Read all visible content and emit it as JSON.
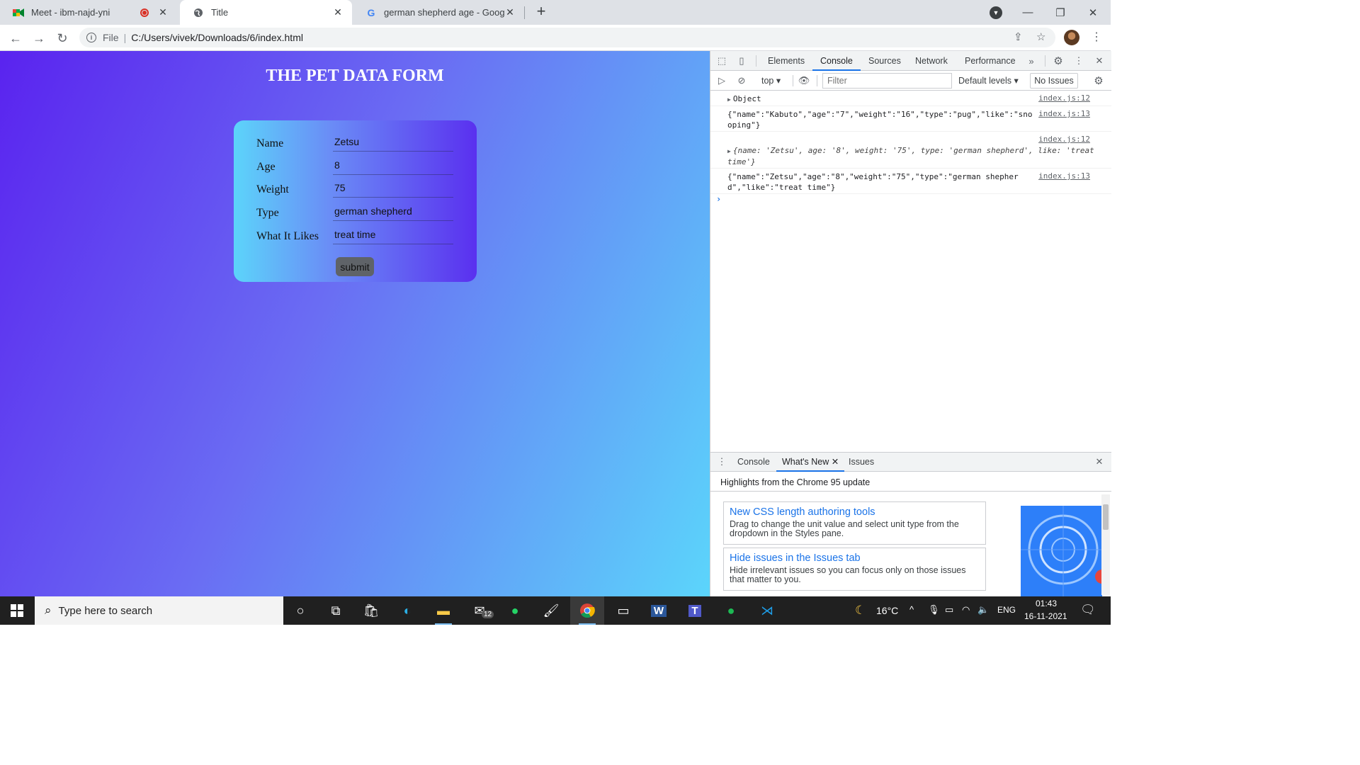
{
  "tabs": [
    {
      "title": "Meet - ibm-najd-yni"
    },
    {
      "title": "Title"
    },
    {
      "title": "german shepherd age - Google S"
    }
  ],
  "address": {
    "scheme": "File",
    "path": "C:/Users/vivek/Downloads/6/index.html"
  },
  "page": {
    "heading": "THE PET DATA FORM",
    "fields": [
      {
        "label": "Name",
        "value": "Zetsu"
      },
      {
        "label": "Age",
        "value": "8"
      },
      {
        "label": "Weight",
        "value": "75"
      },
      {
        "label": "Type",
        "value": "german shepherd"
      },
      {
        "label": "What It Likes",
        "value": "treat time"
      }
    ],
    "submit_label": "submit"
  },
  "devtools": {
    "tabs": [
      "Elements",
      "Console",
      "Sources",
      "Network",
      "Performance"
    ],
    "active_tab": "Console",
    "context": "top",
    "filter_placeholder": "Filter",
    "levels": "Default levels",
    "issues": "No Issues",
    "messages": [
      {
        "text": "Object",
        "source": "index.js:12"
      },
      {
        "text": "{\"name\":\"Kabuto\",\"age\":\"7\",\"weight\":\"16\",\"type\":\"pug\",\"like\":\"snooping\"}",
        "source": "index.js:13"
      },
      {
        "text": "{name: 'Zetsu', age: '8', weight: '75', type: 'german shepherd', like: 'treat time'}",
        "source": "index.js:12"
      },
      {
        "text": "{\"name\":\"Zetsu\",\"age\":\"8\",\"weight\":\"75\",\"type\":\"german shepherd\",\"like\":\"treat time\"}",
        "source": "index.js:13"
      }
    ],
    "drawer": {
      "tabs": [
        "Console",
        "What's New",
        "Issues"
      ],
      "active_tab": "What's New",
      "heading": "Highlights from the Chrome 95 update",
      "items": [
        {
          "title": "New CSS length authoring tools",
          "desc": "Drag to change the unit value and select unit type from the dropdown in the Styles pane."
        },
        {
          "title": "Hide issues in the Issues tab",
          "desc": "Hide irrelevant issues so you can focus only on those issues that matter to you."
        }
      ]
    }
  },
  "taskbar": {
    "search_placeholder": "Type here to search",
    "mail_badge": "12",
    "weather": "16°C",
    "language": "ENG",
    "time": "01:43",
    "date": "16-11-2021"
  }
}
